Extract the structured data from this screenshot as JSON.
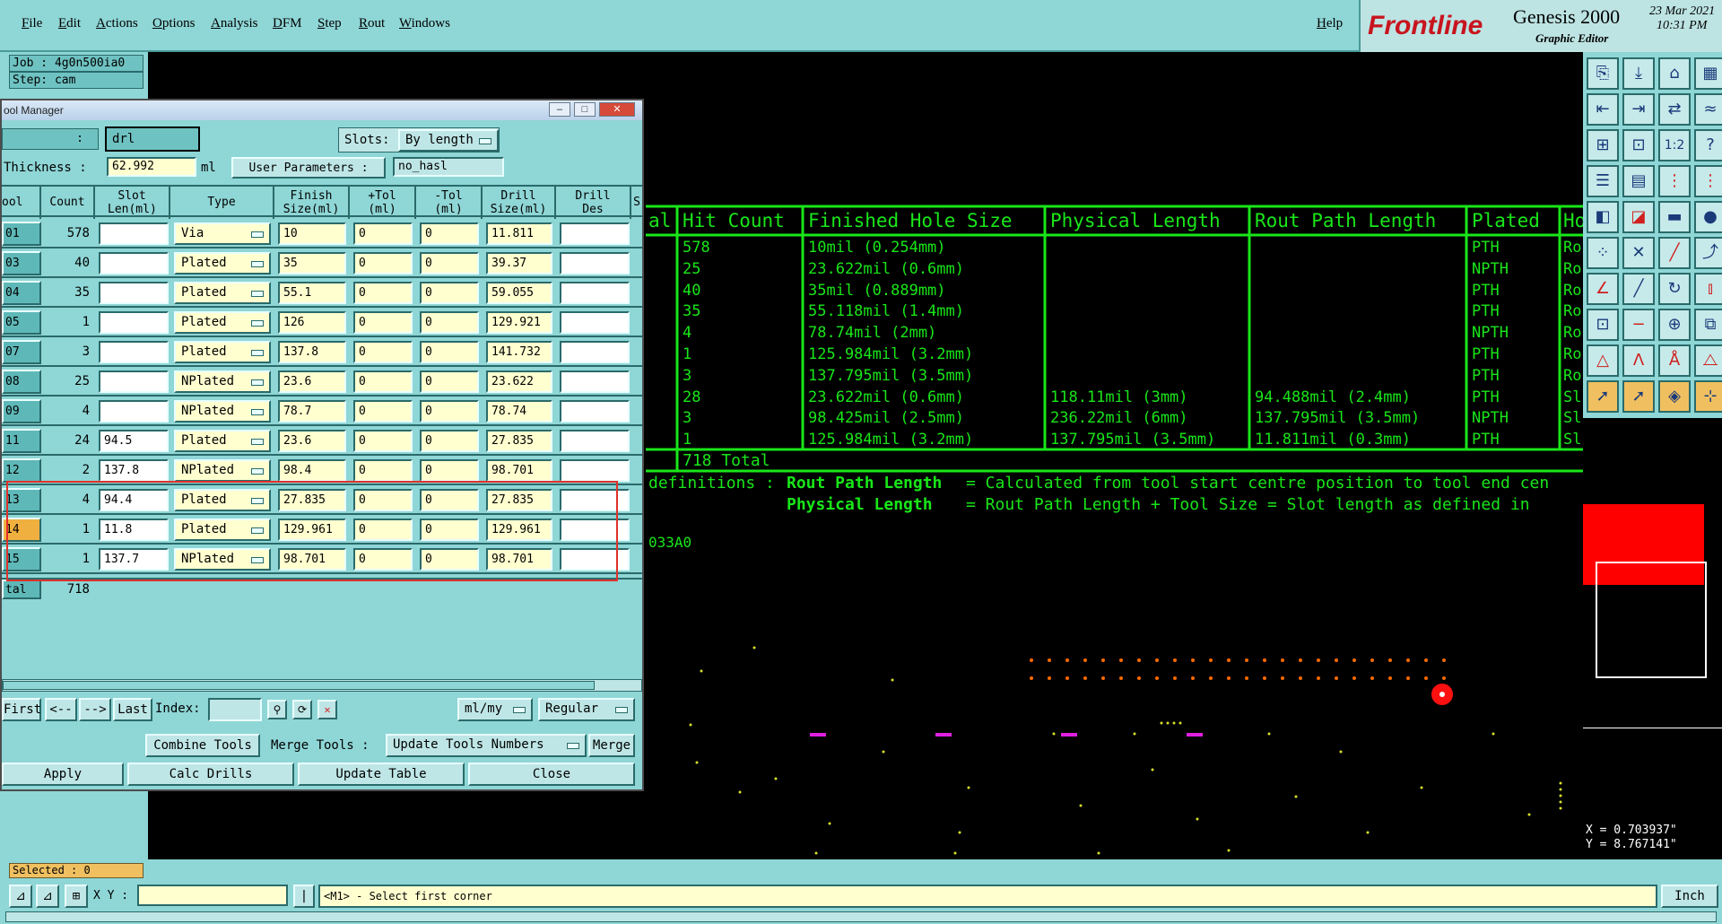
{
  "menu": [
    "File",
    "Edit",
    "Actions",
    "Options",
    "Analysis",
    "DFM",
    "Step",
    "Rout",
    "Windows"
  ],
  "help_label": "Help",
  "brand": {
    "logo": "Frontline",
    "product": "Genesis 2000",
    "subtitle": "Graphic Editor",
    "date": "23 Mar 2021",
    "time": "10:31 PM"
  },
  "job": {
    "job": "Job : 4g0n500ia0",
    "step": "Step: cam"
  },
  "tool_manager": {
    "title": "ool Manager",
    "layer_label": ":",
    "layer_value": "drl",
    "slots_label": "Slots:",
    "slots_value": "By length",
    "thickness_label": "Thickness :",
    "thickness_value": "62.992",
    "thickness_unit": "ml",
    "user_params_label": "User Parameters :",
    "user_params_value": "no_hasl",
    "headers": [
      "ool",
      "Count",
      "Slot Len(ml)",
      "Type",
      "Finish Size(ml)",
      "+Tol (ml)",
      "-Tol (ml)",
      "Drill Size(ml)",
      "Drill Des",
      "S"
    ],
    "rows": [
      {
        "tool": "01",
        "count": "578",
        "slot": "",
        "type": "Via",
        "finish": "10",
        "ptol": "0",
        "mtol": "0",
        "drill": "11.811",
        "des": ""
      },
      {
        "tool": "03",
        "count": "40",
        "slot": "",
        "type": "Plated",
        "finish": "35",
        "ptol": "0",
        "mtol": "0",
        "drill": "39.37",
        "des": ""
      },
      {
        "tool": "04",
        "count": "35",
        "slot": "",
        "type": "Plated",
        "finish": "55.1",
        "ptol": "0",
        "mtol": "0",
        "drill": "59.055",
        "des": ""
      },
      {
        "tool": "05",
        "count": "1",
        "slot": "",
        "type": "Plated",
        "finish": "126",
        "ptol": "0",
        "mtol": "0",
        "drill": "129.921",
        "des": ""
      },
      {
        "tool": "07",
        "count": "3",
        "slot": "",
        "type": "Plated",
        "finish": "137.8",
        "ptol": "0",
        "mtol": "0",
        "drill": "141.732",
        "des": ""
      },
      {
        "tool": "08",
        "count": "25",
        "slot": "",
        "type": "NPlated",
        "finish": "23.6",
        "ptol": "0",
        "mtol": "0",
        "drill": "23.622",
        "des": ""
      },
      {
        "tool": "09",
        "count": "4",
        "slot": "",
        "type": "NPlated",
        "finish": "78.7",
        "ptol": "0",
        "mtol": "0",
        "drill": "78.74",
        "des": ""
      },
      {
        "tool": "11",
        "count": "24",
        "slot": "94.5",
        "type": "Plated",
        "finish": "23.6",
        "ptol": "0",
        "mtol": "0",
        "drill": "27.835",
        "des": ""
      },
      {
        "tool": "12",
        "count": "2",
        "slot": "137.8",
        "type": "NPlated",
        "finish": "98.4",
        "ptol": "0",
        "mtol": "0",
        "drill": "98.701",
        "des": ""
      },
      {
        "tool": "13",
        "count": "4",
        "slot": "94.4",
        "type": "Plated",
        "finish": "27.835",
        "ptol": "0",
        "mtol": "0",
        "drill": "27.835",
        "des": ""
      },
      {
        "tool": "14",
        "count": "1",
        "slot": "11.8",
        "type": "Plated",
        "finish": "129.961",
        "ptol": "0",
        "mtol": "0",
        "drill": "129.961",
        "des": ""
      },
      {
        "tool": "15",
        "count": "1",
        "slot": "137.7",
        "type": "NPlated",
        "finish": "98.701",
        "ptol": "0",
        "mtol": "0",
        "drill": "98.701",
        "des": ""
      }
    ],
    "total_label": "tal",
    "total_count": "718",
    "nav": {
      "first": "First",
      "prev": "<--",
      "next": "-->",
      "last": "Last",
      "index_label": "Index:",
      "units": "ml/my",
      "mode": "Regular"
    },
    "buttons": {
      "combine": "Combine Tools",
      "merge_tools": "Merge Tools :",
      "update_numbers": "Update Tools Numbers",
      "merge": "Merge",
      "apply": "Apply",
      "calc": "Calc Drills",
      "update_table": "Update Table",
      "close": "Close"
    }
  },
  "drill_table": {
    "headers": [
      "al",
      "Hit Count",
      "Finished Hole Size",
      "Physical Length",
      "Rout Path Length",
      "Plated",
      "Ho"
    ],
    "rows": [
      {
        "hit": "578",
        "finish": "10mil (0.254mm)",
        "phys": "",
        "rout": "",
        "plated": "PTH",
        "ho": "Ro"
      },
      {
        "hit": "25",
        "finish": "23.622mil (0.6mm)",
        "phys": "",
        "rout": "",
        "plated": "NPTH",
        "ho": "Ro"
      },
      {
        "hit": "40",
        "finish": "35mil (0.889mm)",
        "phys": "",
        "rout": "",
        "plated": "PTH",
        "ho": "Ro"
      },
      {
        "hit": "35",
        "finish": "55.118mil (1.4mm)",
        "phys": "",
        "rout": "",
        "plated": "PTH",
        "ho": "Ro"
      },
      {
        "hit": "4",
        "finish": "78.74mil (2mm)",
        "phys": "",
        "rout": "",
        "plated": "NPTH",
        "ho": "Ro"
      },
      {
        "hit": "1",
        "finish": "125.984mil (3.2mm)",
        "phys": "",
        "rout": "",
        "plated": "PTH",
        "ho": "Ro"
      },
      {
        "hit": "3",
        "finish": "137.795mil (3.5mm)",
        "phys": "",
        "rout": "",
        "plated": "PTH",
        "ho": "Ro"
      },
      {
        "hit": "28",
        "finish": "23.622mil (0.6mm)",
        "phys": "118.11mil (3mm)",
        "rout": "94.488mil (2.4mm)",
        "plated": "PTH",
        "ho": "Sl"
      },
      {
        "hit": "3",
        "finish": "98.425mil (2.5mm)",
        "phys": "236.22mil (6mm)",
        "rout": "137.795mil (3.5mm)",
        "plated": "NPTH",
        "ho": "Sl"
      },
      {
        "hit": "1",
        "finish": "125.984mil (3.2mm)",
        "phys": "137.795mil (3.5mm)",
        "rout": "11.811mil (0.3mm)",
        "plated": "PTH",
        "ho": "Sl"
      }
    ],
    "total": "718 Total",
    "def_label": "definitions :",
    "def1_term": "Rout Path Length",
    "def1_text": "= Calculated from tool start centre position to tool end cen",
    "def2_term": "Physical Length",
    "def2_text": "= Rout Path Length + Tool Size = Slot length as defined in",
    "code": "033A0"
  },
  "coords": {
    "x": "X = 0.703937\"",
    "y": "Y = 8.767141\""
  },
  "status": {
    "selected": "Selected : 0",
    "xy_label": "X Y :",
    "prompt": "<M1> - Select first corner",
    "units": "Inch"
  },
  "colors": {
    "pcb_green": "#19e619",
    "panel": "#8fd6d6",
    "highlight": "#e0302a"
  }
}
